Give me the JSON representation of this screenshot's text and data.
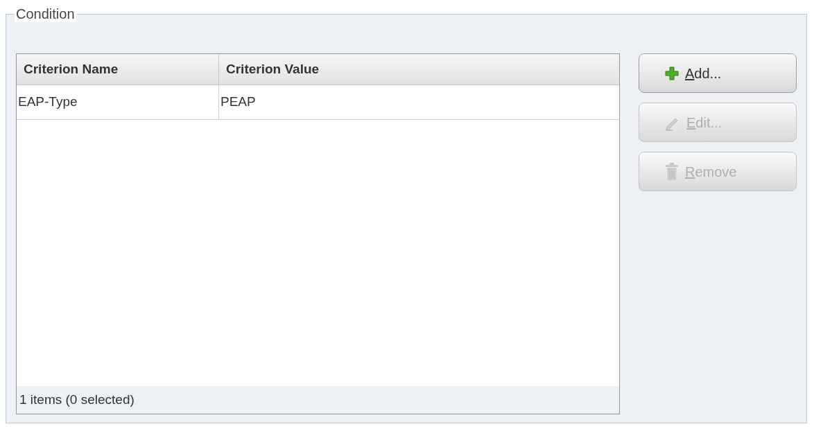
{
  "group": {
    "title": "Condition"
  },
  "table": {
    "columns": [
      "Criterion Name",
      "Criterion Value"
    ],
    "rows": [
      {
        "cells": [
          "EAP-Type",
          "PEAP"
        ],
        "selected": false
      }
    ],
    "footer": "1 items (0 selected)"
  },
  "buttons": [
    {
      "label": "Add...",
      "kind": "add",
      "disabled": false
    },
    {
      "label": "Edit...",
      "kind": "edit",
      "disabled": true
    },
    {
      "label": "Remove",
      "kind": "remove",
      "disabled": true
    }
  ]
}
